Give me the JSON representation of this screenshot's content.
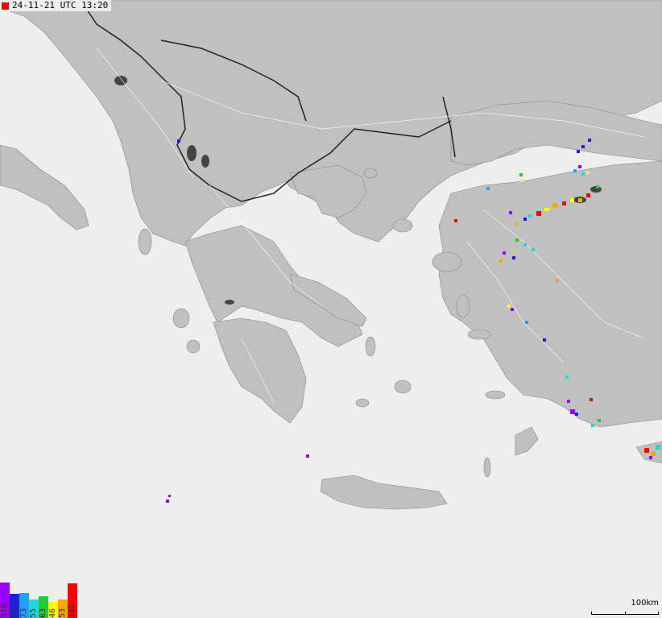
{
  "timestamp": {
    "text": "24-11-21 UTC 13:20",
    "marker_color": "#ee0000"
  },
  "colors": {
    "sea": "#eeeeee",
    "land": "#c0c0c0",
    "lake": "#444444",
    "border": "#222222",
    "road": "#ffffff"
  },
  "legend": [
    {
      "label": "116",
      "color": "#9a00ff",
      "level": 0.85
    },
    {
      "label": "71",
      "color": "#1f1fd6",
      "level": 0.58
    },
    {
      "label": "73",
      "color": "#23a0ff",
      "level": 0.6
    },
    {
      "label": "55",
      "color": "#20d8d8",
      "level": 0.45
    },
    {
      "label": "63",
      "color": "#22cc33",
      "level": 0.52
    },
    {
      "label": "46",
      "color": "#ffff00",
      "level": 0.38
    },
    {
      "label": "53",
      "color": "#ffa500",
      "level": 0.44
    },
    {
      "label": "105",
      "color": "#ff0000",
      "level": 0.82
    }
  ],
  "scale": {
    "label": "100km"
  }
}
